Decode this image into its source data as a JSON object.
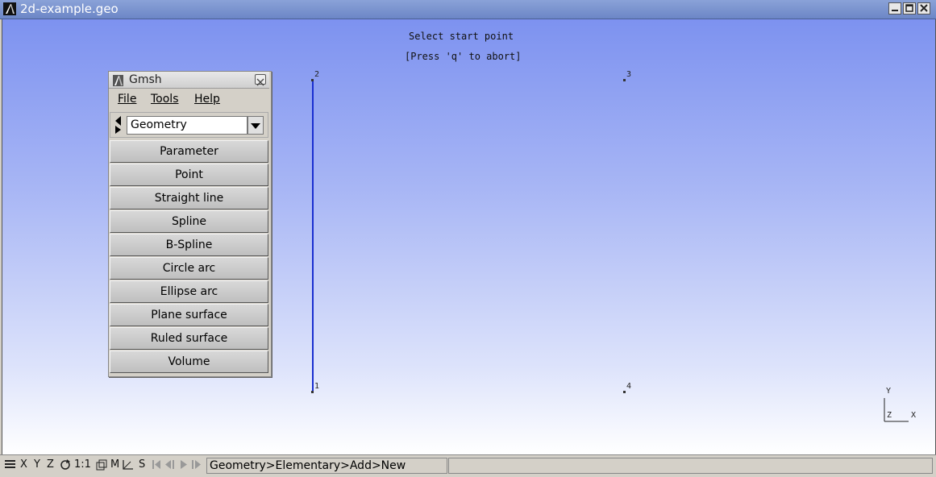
{
  "window": {
    "title": "2d-example.geo"
  },
  "viewport": {
    "message_line1": "Select start point",
    "message_line2": "[Press 'q' to abort]",
    "points": [
      {
        "label": "1"
      },
      {
        "label": "2"
      },
      {
        "label": "3"
      },
      {
        "label": "4"
      }
    ],
    "axes": {
      "y": "Y",
      "z": "Z",
      "x": "X"
    },
    "line_color": "#1a2fd0"
  },
  "gmsh_panel": {
    "title": "Gmsh",
    "menu": {
      "file": "File",
      "tools": "Tools",
      "help": "Help"
    },
    "module_selected": "Geometry",
    "buttons": [
      "Parameter",
      "Point",
      "Straight line",
      "Spline",
      "B-Spline",
      "Circle arc",
      "Ellipse arc",
      "Plane surface",
      "Ruled surface",
      "Volume"
    ]
  },
  "statusbar": {
    "x": "X",
    "y": "Y",
    "z": "Z",
    "scale": "1:1",
    "m": "M",
    "s": "S",
    "breadcrumb": "Geometry>Elementary>Add>New",
    "message": ""
  }
}
